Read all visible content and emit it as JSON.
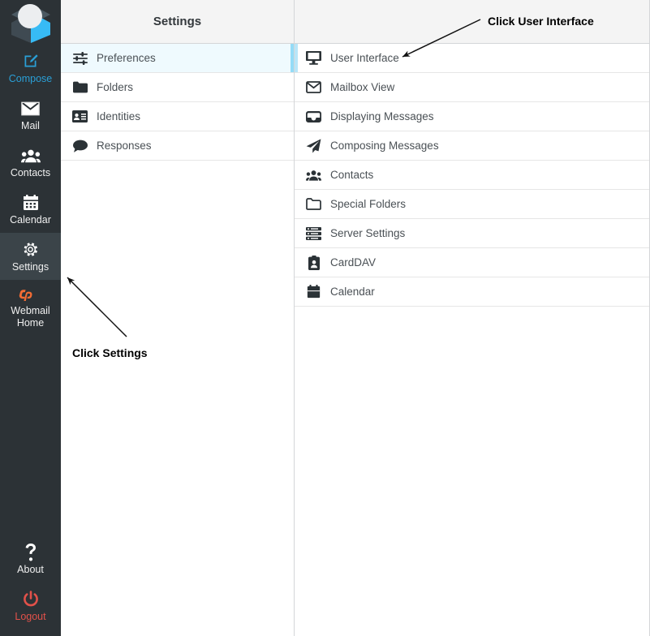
{
  "app": {
    "logo_name": "roundcube-logo"
  },
  "taskbar": {
    "items": [
      {
        "id": "compose",
        "label": "Compose",
        "icon": "compose-icon",
        "state": "accent"
      },
      {
        "id": "mail",
        "label": "Mail",
        "icon": "envelope-icon",
        "state": "normal"
      },
      {
        "id": "contacts",
        "label": "Contacts",
        "icon": "contacts-icon",
        "state": "normal"
      },
      {
        "id": "calendar",
        "label": "Calendar",
        "icon": "calendar-icon",
        "state": "normal"
      },
      {
        "id": "settings",
        "label": "Settings",
        "icon": "gear-icon",
        "state": "active"
      },
      {
        "id": "webmail-home",
        "label": "Webmail\nHome",
        "icon": "cpanel-icon",
        "state": "normal"
      }
    ],
    "bottom_items": [
      {
        "id": "about",
        "label": "About",
        "icon": "question-mark-icon",
        "state": "normal"
      },
      {
        "id": "logout",
        "label": "Logout",
        "icon": "power-icon",
        "state": "danger"
      }
    ]
  },
  "settings_column": {
    "title": "Settings",
    "items": [
      {
        "label": "Preferences",
        "icon": "sliders-icon",
        "selected": true
      },
      {
        "label": "Folders",
        "icon": "folder-filled-icon",
        "selected": false
      },
      {
        "label": "Identities",
        "icon": "id-card-icon",
        "selected": false
      },
      {
        "label": "Responses",
        "icon": "speech-bubble-icon",
        "selected": false
      }
    ]
  },
  "preferences_column": {
    "title": "",
    "items": [
      {
        "label": "User Interface",
        "icon": "monitor-icon",
        "focused": true
      },
      {
        "label": "Mailbox View",
        "icon": "envelope-outline-icon",
        "focused": false
      },
      {
        "label": "Displaying Messages",
        "icon": "inbox-icon",
        "focused": false
      },
      {
        "label": "Composing Messages",
        "icon": "paper-plane-icon",
        "focused": false
      },
      {
        "label": "Contacts",
        "icon": "contacts-icon",
        "focused": false
      },
      {
        "label": "Special Folders",
        "icon": "folder-outline-icon",
        "focused": false
      },
      {
        "label": "Server Settings",
        "icon": "server-icon",
        "focused": false
      },
      {
        "label": "CardDAV",
        "icon": "id-badge-icon",
        "focused": false
      },
      {
        "label": "Calendar",
        "icon": "calendar-icon",
        "focused": false
      }
    ]
  },
  "annotations": {
    "user_interface": "Click User Interface",
    "settings": "Click Settings"
  },
  "colors": {
    "taskbar_bg": "#2c3236",
    "taskbar_active_bg": "#3b4449",
    "accent": "#2a9fd6",
    "danger": "#e2514a",
    "selected_row_bg": "#effafe",
    "selected_row_edge": "#94dcf7",
    "header_bg": "#f4f4f4",
    "border": "#d4d6d8"
  }
}
